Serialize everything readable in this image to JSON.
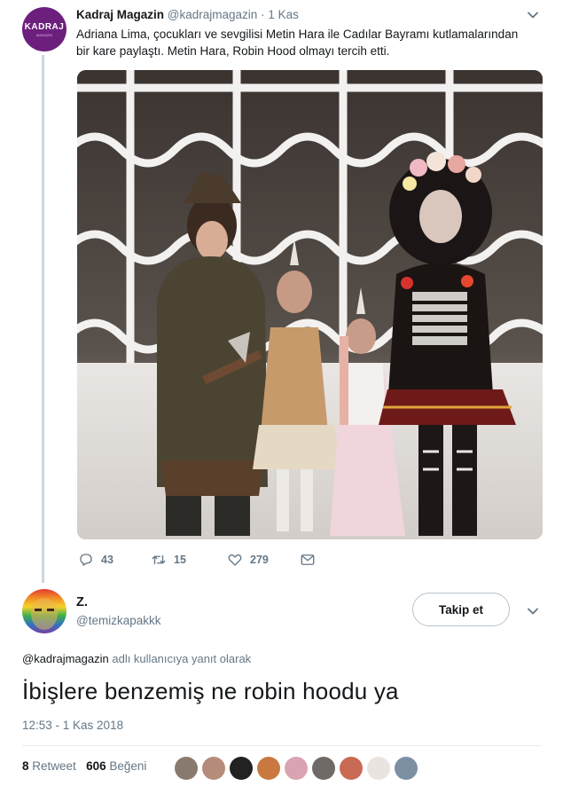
{
  "quoted_tweet": {
    "author_name": "Kadraj Magazin",
    "author_handle": "@kadrajmagazin",
    "separator": "·",
    "time": "1 Kas",
    "avatar_logo": "KADRAJ",
    "avatar_sub": "MAGAZIN",
    "text": "Adriana Lima, çocukları ve sevgilisi Metin Hara ile Cadılar Bayramı kutlamalarından bir kare paylaştı. Metin Hara, Robin Hood olmayı tercih etti.",
    "actions": {
      "reply_count": "43",
      "retweet_count": "15",
      "like_count": "279"
    },
    "icons": [
      "reply-icon",
      "retweet-icon",
      "like-icon",
      "message-icon",
      "chevron-down-icon"
    ]
  },
  "reply_tweet": {
    "author_name": "Z.",
    "author_handle": "@temizkapakkk",
    "follow_label": "Takip et",
    "reply_context_mention": "@kadrajmagazin",
    "reply_context_suffix": " adlı kullanıcıya yanıt olarak",
    "text": "İbişlere benzemiş ne robin hoodu ya",
    "timestamp": "12:53 - 1 Kas 2018",
    "retweet_count": "8",
    "retweet_label": " Retweet",
    "like_count": "606",
    "like_label": " Beğeni"
  },
  "colors": {
    "text_primary": "#14171a",
    "text_secondary": "#657786",
    "thread_line": "#ccd6dd",
    "kadraj_brand": "#6d1f7e",
    "divider": "#e6ecf0"
  }
}
